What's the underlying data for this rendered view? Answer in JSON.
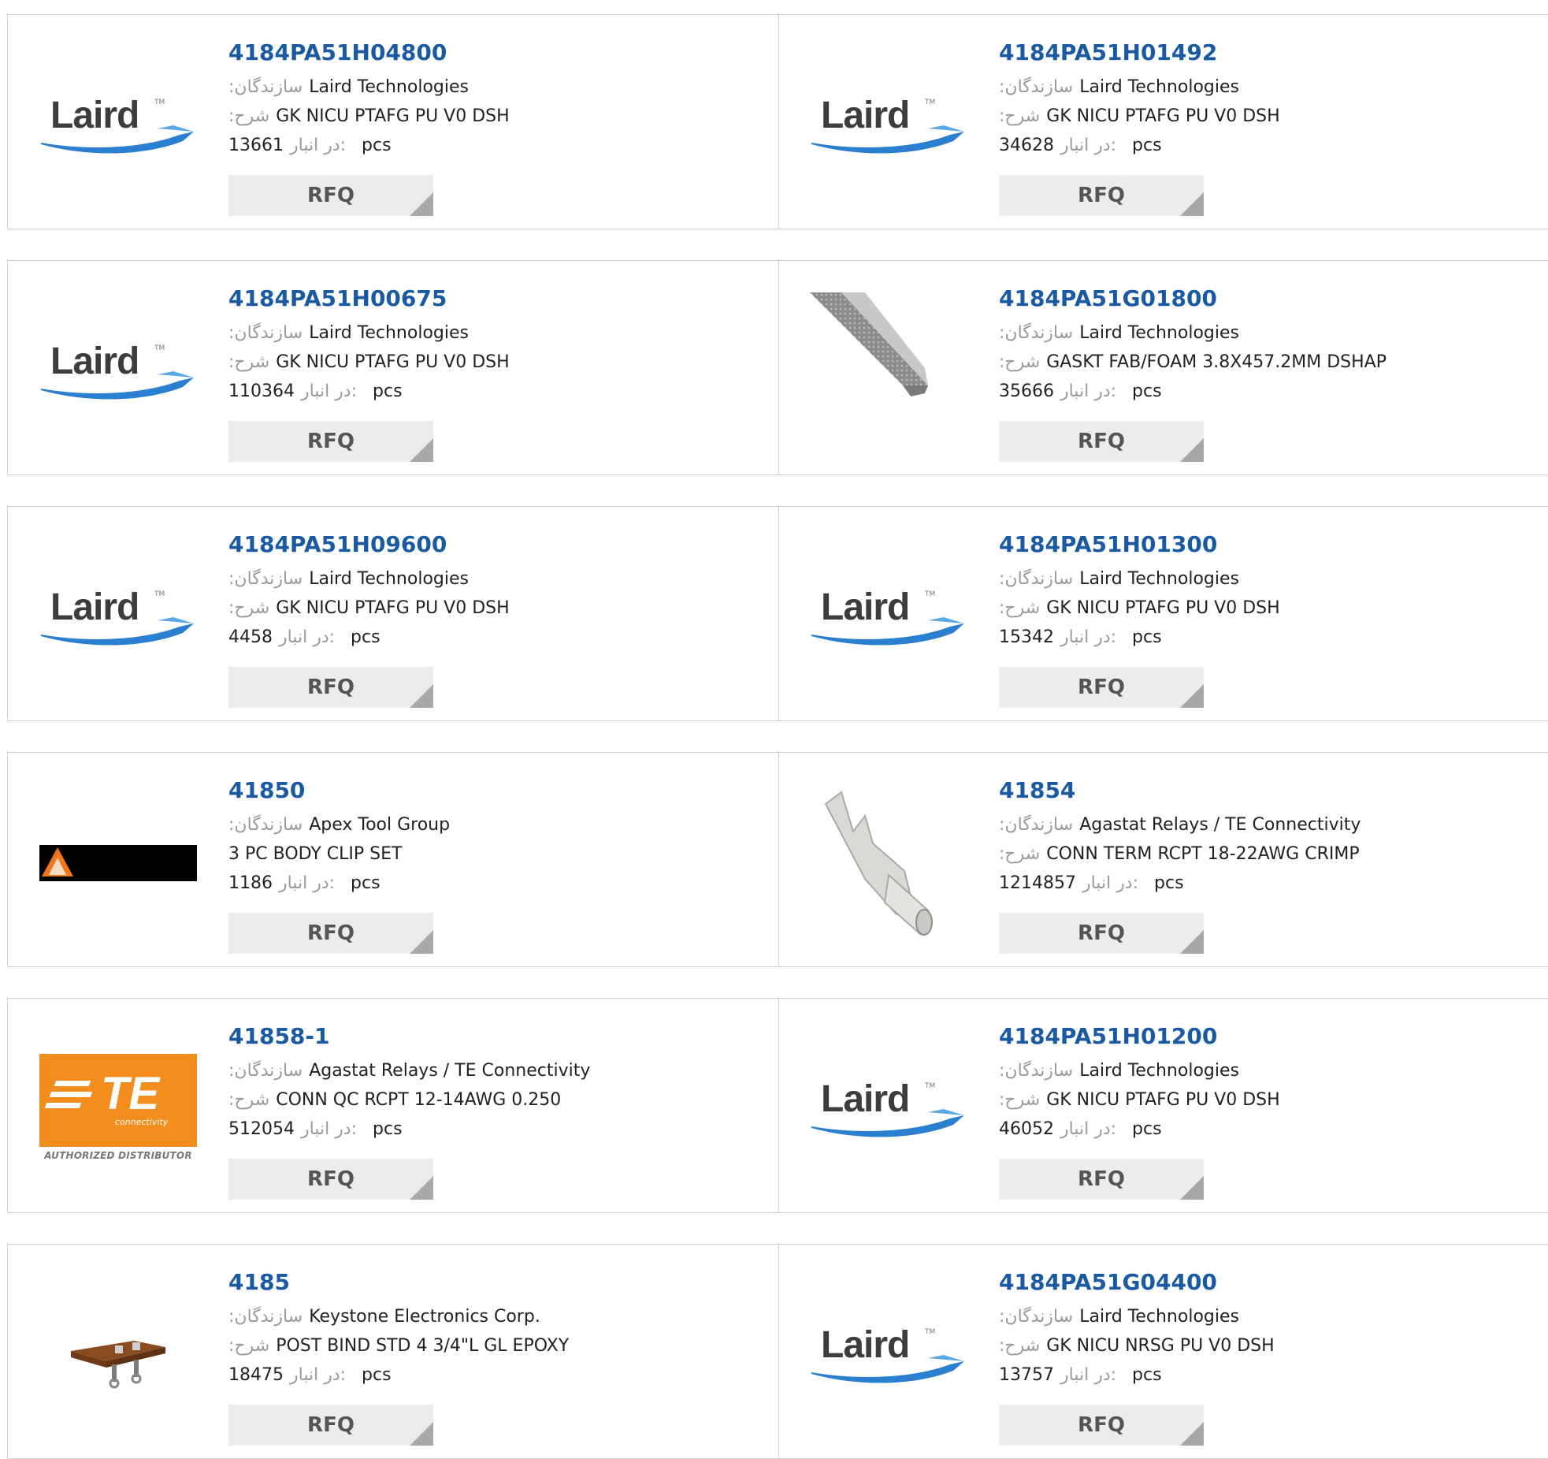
{
  "labels": {
    "manufacturer": ":سازندگان",
    "description": ":شرح",
    "stock": "در انبار:",
    "rfq": "RFQ"
  },
  "logo_text": {
    "laird": "Laird",
    "te": "TE",
    "te_sub": "connectivity",
    "te_auth": "AUTHORIZED DISTRIBUTOR"
  },
  "products": [
    {
      "part": "4184PA51H04800",
      "manufacturer": "Laird Technologies",
      "description": "GK NICU PTAFG PU V0 DSH",
      "stock": "13661",
      "unit": "pcs",
      "image": "laird-logo"
    },
    {
      "part": "4184PA51H01492",
      "manufacturer": "Laird Technologies",
      "description": "GK NICU PTAFG PU V0 DSH",
      "stock": "34628",
      "unit": "pcs",
      "image": "laird-logo"
    },
    {
      "part": "4184PA51H00675",
      "manufacturer": "Laird Technologies",
      "description": "GK NICU PTAFG PU V0 DSH",
      "stock": "110364",
      "unit": "pcs",
      "image": "laird-logo"
    },
    {
      "part": "4184PA51G01800",
      "manufacturer": "Laird Technologies",
      "description": "GASKT FAB/FOAM 3.8X457.2MM DSHAP",
      "stock": "35666",
      "unit": "pcs",
      "image": "gasket-photo"
    },
    {
      "part": "4184PA51H09600",
      "manufacturer": "Laird Technologies",
      "description": "GK NICU PTAFG PU V0 DSH",
      "stock": "4458",
      "unit": "pcs",
      "image": "laird-logo"
    },
    {
      "part": "4184PA51H01300",
      "manufacturer": "Laird Technologies",
      "description": "GK NICU PTAFG PU V0 DSH",
      "stock": "15342",
      "unit": "pcs",
      "image": "laird-logo"
    },
    {
      "part": "41850",
      "manufacturer": "Apex Tool Group",
      "description": "3 PC BODY CLIP SET",
      "stock": "1186",
      "unit": "pcs",
      "image": "apex-logo"
    },
    {
      "part": "41854",
      "manufacturer": "Agastat Relays / TE Connectivity",
      "description": "CONN TERM RCPT 18-22AWG CRIMP",
      "stock": "1214857",
      "unit": "pcs",
      "image": "terminal-photo"
    },
    {
      "part": "41858-1",
      "manufacturer": "Agastat Relays / TE Connectivity",
      "description": "CONN QC RCPT 12-14AWG 0.250",
      "stock": "512054",
      "unit": "pcs",
      "image": "te-logo"
    },
    {
      "part": "4184PA51H01200",
      "manufacturer": "Laird Technologies",
      "description": "GK NICU PTAFG PU V0 DSH",
      "stock": "46052",
      "unit": "pcs",
      "image": "laird-logo"
    },
    {
      "part": "4185",
      "manufacturer": "Keystone Electronics Corp.",
      "description": "POST BIND STD 4 3/4\"L GL EPOXY",
      "stock": "18475",
      "unit": "pcs",
      "image": "binding-post-photo"
    },
    {
      "part": "4184PA51G04400",
      "manufacturer": "Laird Technologies",
      "description": "GK NICU NRSG PU V0 DSH",
      "stock": "13757",
      "unit": "pcs",
      "image": "laird-logo"
    }
  ],
  "colors": {
    "link": "#1a5aa3",
    "border": "#cfcfcf",
    "rfq_bg": "#ececec",
    "te_orange": "#f28d1e",
    "laird_swoosh": "#2a7fd0"
  }
}
